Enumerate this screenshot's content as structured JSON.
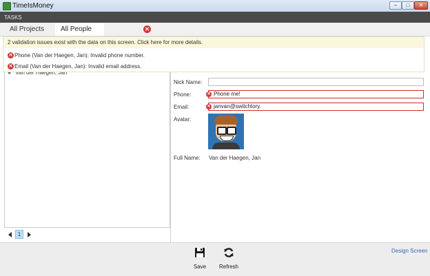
{
  "window": {
    "title": "TimeIsMoney",
    "min_label": "–",
    "max_label": "□",
    "close_label": "✕"
  },
  "tasks_bar": {
    "label": "TASKS"
  },
  "tabs": [
    {
      "label": "All Projects"
    },
    {
      "label": "All People",
      "has_error": true
    }
  ],
  "validation": {
    "summary": "2 validation issues exist with the data on this screen. Click here for more details.",
    "items": [
      "Phone (Van der Haegen, Jan): Invalid phone number.",
      "Email (Van der Haegen, Jan): Invalid email address."
    ]
  },
  "list": {
    "items": [
      "Van der Haegen, Jan"
    ],
    "pager": {
      "current_page": "1"
    }
  },
  "details": {
    "nick_name_label": "Nick Name:",
    "nick_name_value": "",
    "phone_label": "Phone:",
    "phone_value": "Phone me!",
    "email_label": "Email:",
    "email_value": "janvan@switchtory.",
    "avatar_label": "Avatar:",
    "full_name_label": "Full Name:",
    "full_name_value": "Van der Haegen, Jan"
  },
  "footer": {
    "save_label": "Save",
    "refresh_label": "Refresh",
    "design_screen_label": "Design Screen"
  },
  "colors": {
    "error": "#d23a3a",
    "summary_background": "#fbf7dc",
    "tasks_bar": "#4a4a4a",
    "link": "#2b6cb0"
  }
}
